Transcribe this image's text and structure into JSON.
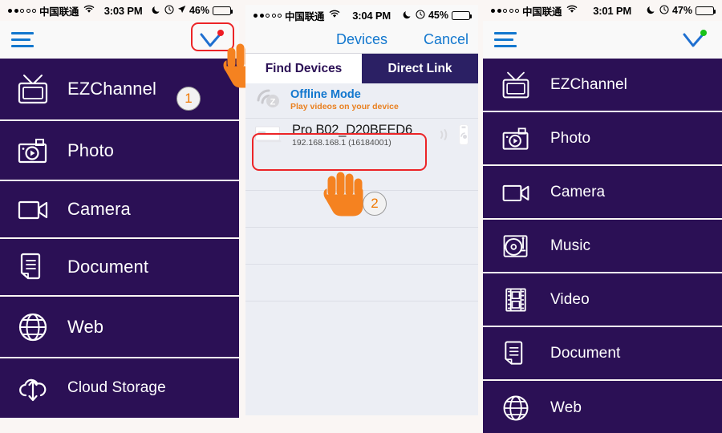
{
  "colors": {
    "purple": "#2b1055",
    "purple_tab": "#2b2064",
    "blue": "#1277ce",
    "orange": "#f07800",
    "red_highlight": "#ec2427",
    "page_bg": "#faf6f4",
    "list_bg": "#eceef4",
    "badge_red": "#ee1c25",
    "badge_green": "#19c219"
  },
  "left_panel": {
    "status_bar": {
      "signal_dots": "••○○○",
      "carrier": "中国联通",
      "wifi_icon": "wifi-icon",
      "time": "3:03 PM",
      "moon_icon": "moon-icon",
      "alarm_icon": "alarm-clock-icon",
      "location_icon": "location-arrow-icon",
      "battery_percent": "46%",
      "battery_level": 46
    },
    "header": {
      "menu_icon": "hamburger-menu-icon",
      "connect_icon": "checkmark-icon",
      "badge_color": "#ee1c25"
    },
    "menu_items": [
      {
        "label": "EZChannel",
        "icon": "tv-icon"
      },
      {
        "label": "Photo",
        "icon": "camera-photo-icon"
      },
      {
        "label": "Camera",
        "icon": "video-camera-icon"
      },
      {
        "label": "Document",
        "icon": "document-icon"
      },
      {
        "label": "Web",
        "icon": "globe-icon"
      },
      {
        "label": "Cloud Storage",
        "icon": "cloud-upload-icon"
      }
    ],
    "annotation": {
      "step": "1"
    }
  },
  "mid_panel": {
    "status_bar": {
      "signal_dots": "••○○○",
      "carrier": "中国联通",
      "wifi_icon": "wifi-icon",
      "time": "3:04 PM",
      "moon_icon": "moon-icon",
      "alarm_icon": "alarm-clock-icon",
      "battery_percent": "45%",
      "battery_level": 45
    },
    "navbar": {
      "title": "Devices",
      "cancel": "Cancel"
    },
    "tabs": [
      {
        "label": "Find Devices",
        "active": false
      },
      {
        "label": "Direct Link",
        "active": true
      }
    ],
    "offline_mode": {
      "icon": "ez-wifi-icon",
      "title": "Offline Mode",
      "subtitle": "Play videos on your device"
    },
    "device": {
      "thumb_icon": "projector-device-icon",
      "name": "Pro B02_D20BEED6",
      "detail": "192.168.168.1 (16184001)",
      "signal_icon": "wifi-signal-icon",
      "dongle_icon": "usb-dongle-icon"
    },
    "empty_rows": 5,
    "annotation": {
      "step": "2"
    }
  },
  "right_panel": {
    "status_bar": {
      "signal_dots": "••○○○",
      "carrier": "中国联通",
      "wifi_icon": "wifi-icon",
      "time": "3:01 PM",
      "moon_icon": "moon-icon",
      "alarm_icon": "alarm-clock-icon",
      "battery_percent": "47%",
      "battery_level": 47
    },
    "header": {
      "menu_icon": "hamburger-menu-icon",
      "connect_icon": "checkmark-icon",
      "badge_color": "#19c219"
    },
    "menu_items": [
      {
        "label": "EZChannel",
        "icon": "tv-icon"
      },
      {
        "label": "Photo",
        "icon": "camera-photo-icon"
      },
      {
        "label": "Camera",
        "icon": "video-camera-icon"
      },
      {
        "label": "Music",
        "icon": "turntable-icon"
      },
      {
        "label": "Video",
        "icon": "film-strip-icon"
      },
      {
        "label": "Document",
        "icon": "document-icon"
      },
      {
        "label": "Web",
        "icon": "globe-icon"
      }
    ]
  }
}
